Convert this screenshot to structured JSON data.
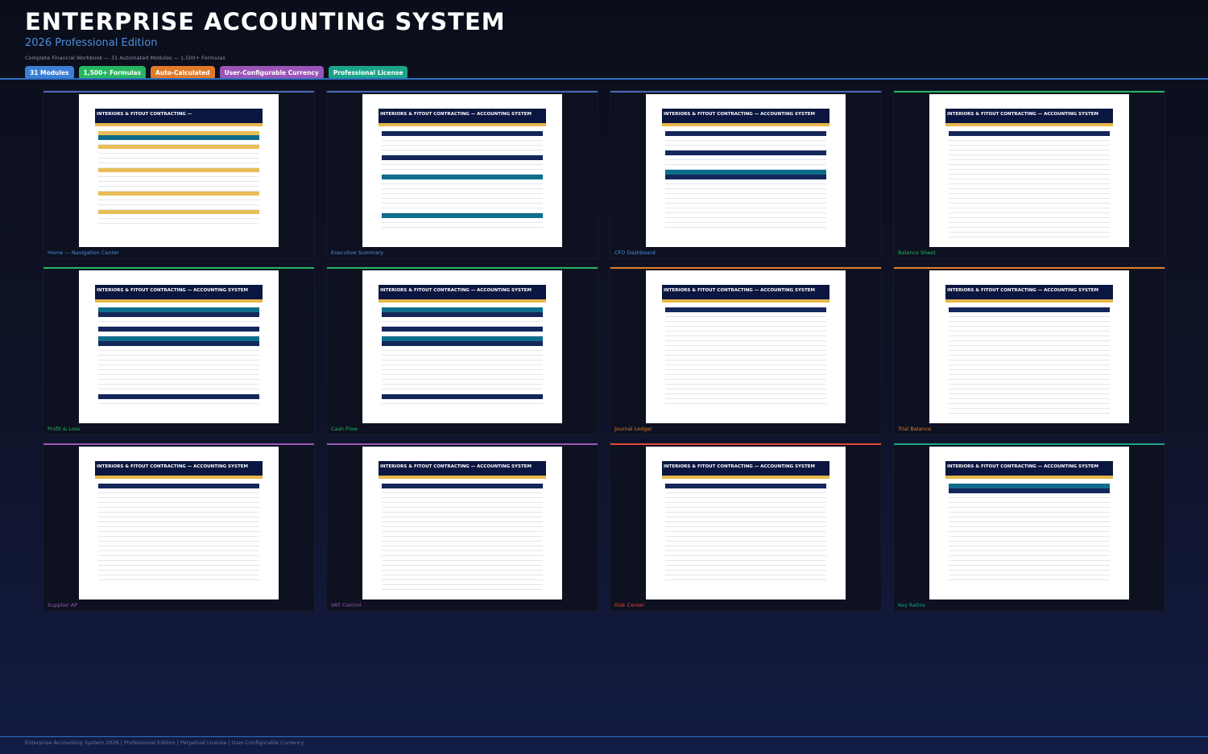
{
  "header": {
    "title": "ENTERPRISE ACCOUNTING SYSTEM",
    "subtitle": "2026 Professional Edition",
    "tagline": "Complete Financial Workbook — 31 Automated Modules — 1,500+ Formulas"
  },
  "badges": [
    {
      "label": "31 Modules",
      "color": "#3d7fd6"
    },
    {
      "label": "1,500+ Formulas",
      "color": "#27b560"
    },
    {
      "label": "Auto-Calculated",
      "color": "#e07a2a"
    },
    {
      "label": "User-Configurable Currency",
      "color": "#9b55b8"
    },
    {
      "label": "Professional License",
      "color": "#1aa589"
    }
  ],
  "cards": [
    {
      "label": "Home — Navigation Center",
      "accent": "#4b68b5",
      "label_color": "#4d8fdb",
      "sheet_title": "INTERIORS & FITOUT CONTRACTING —"
    },
    {
      "label": "Executive Summary",
      "accent": "#4b68b5",
      "label_color": "#4d8fdb",
      "sheet_title": "INTERIORS & FITOUT CONTRACTING — ACCOUNTING SYSTEM"
    },
    {
      "label": "CFO Dashboard",
      "accent": "#4b68b5",
      "label_color": "#4d8fdb",
      "sheet_title": "INTERIORS & FITOUT CONTRACTING — ACCOUNTING SYSTEM"
    },
    {
      "label": "Balance Sheet",
      "accent": "#27b560",
      "label_color": "#27b560",
      "sheet_title": "INTERIORS & FITOUT CONTRACTING — ACCOUNTING SYSTEM"
    },
    {
      "label": "Profit & Loss",
      "accent": "#27b560",
      "label_color": "#27b560",
      "sheet_title": "INTERIORS & FITOUT CONTRACTING — ACCOUNTING SYSTEM"
    },
    {
      "label": "Cash Flow",
      "accent": "#27b560",
      "label_color": "#27b560",
      "sheet_title": "INTERIORS & FITOUT CONTRACTING — ACCOUNTING SYSTEM"
    },
    {
      "label": "Journal Ledger",
      "accent": "#e07a2a",
      "label_color": "#e07a2a",
      "sheet_title": "INTERIORS & FITOUT CONTRACTING — ACCOUNTING SYSTEM"
    },
    {
      "label": "Trial Balance",
      "accent": "#e07a2a",
      "label_color": "#e07a2a",
      "sheet_title": "INTERIORS & FITOUT CONTRACTING — ACCOUNTING SYSTEM"
    },
    {
      "label": "Supplier AP",
      "accent": "#9b55b8",
      "label_color": "#9b55b8",
      "sheet_title": "INTERIORS & FITOUT CONTRACTING — ACCOUNTING SYSTEM"
    },
    {
      "label": "VAT Control",
      "accent": "#9b55b8",
      "label_color": "#9b55b8",
      "sheet_title": "INTERIORS & FITOUT CONTRACTING — ACCOUNTING SYSTEM"
    },
    {
      "label": "Risk Center",
      "accent": "#e0463a",
      "label_color": "#e0463a",
      "sheet_title": "INTERIORS & FITOUT CONTRACTING — ACCOUNTING SYSTEM"
    },
    {
      "label": "Key Ratios",
      "accent": "#1aa589",
      "label_color": "#1aa589",
      "sheet_title": "INTERIORS & FITOUT CONTRACTING — ACCOUNTING SYSTEM"
    }
  ],
  "footer": "Enterprise Accounting System 2026  |  Professional Edition  |  Perpetual License  |  User-Configurable Currency"
}
